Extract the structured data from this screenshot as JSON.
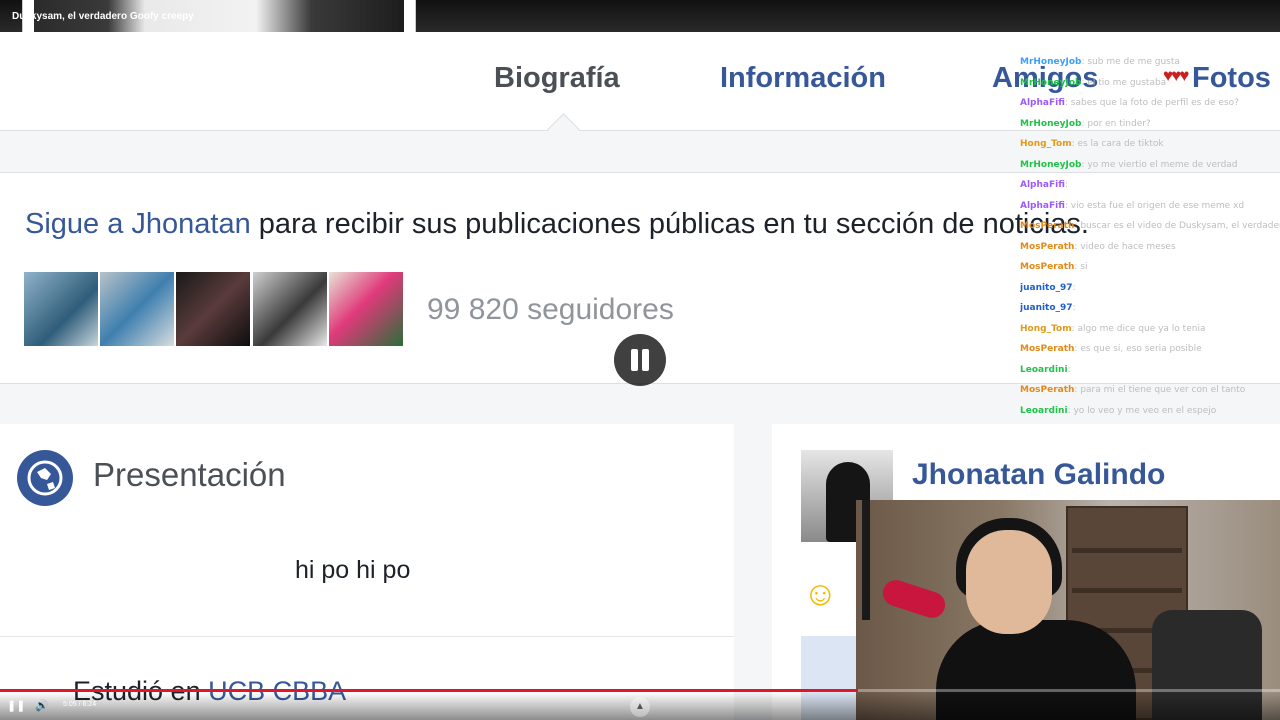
{
  "video": {
    "title": "Duskysam, el verdadero Goofy creepy",
    "time": "5:05 / 6:24",
    "progress": 0.67
  },
  "profile": {
    "tabs": [
      "Biografía",
      "Información",
      "Amigos",
      "Fotos"
    ],
    "follow_link": "Sigue a Jhonatan",
    "follow_rest": " para recibir sus publicaciones públicas en tu sección de noticias.",
    "followers": "99 820 seguidores",
    "intro_title": "Presentación",
    "bio": "hi po hi po",
    "studied_prefix": "Estudió en ",
    "studied_school": "UCB CBBA",
    "side_name": "Jhonatan Galindo"
  },
  "chat": [
    {
      "user": "MrHoneyJob",
      "color": "#3aa0ff",
      "msg": ": sub me de me gusta"
    },
    {
      "user": "MrHoneyJob",
      "color": "#21c24a",
      "msg": ": el tio me gustaba"
    },
    {
      "user": "AlphaFifi",
      "color": "#9b59ff",
      "msg": ": sabes que la foto de perfil es de eso?"
    },
    {
      "user": "MrHoneyJob",
      "color": "#21c24a",
      "msg": ": por en tinder?"
    },
    {
      "user": "Hong_Tom",
      "color": "#e39a1a",
      "msg": ": es la cara de tiktok"
    },
    {
      "user": "MrHoneyJob",
      "color": "#21c24a",
      "msg": ": yo me viertio el meme de verdad"
    },
    {
      "user": "AlphaFifi",
      "color": "#9b59ff",
      "msg": ": "
    },
    {
      "user": "AlphaFifi",
      "color": "#9b59ff",
      "msg": ": vio esta fue el origen de ese meme xd"
    },
    {
      "user": "MosPerath",
      "color": "#e38a1a",
      "msg": ": buscar es el video de Duskysam, el verdadero Goofy creepy, fue el que subio el primero"
    },
    {
      "user": "MosPerath",
      "color": "#e38a1a",
      "msg": ": video de hace meses"
    },
    {
      "user": "MosPerath",
      "color": "#e38a1a",
      "msg": ": si"
    },
    {
      "user": "juanito_97",
      "color": "#1e5fcc",
      "msg": ": "
    },
    {
      "user": "juanito_97",
      "color": "#1e5fcc",
      "msg": ": "
    },
    {
      "user": "Hong_Tom",
      "color": "#e39a1a",
      "msg": ": algo me dice que ya lo tenia"
    },
    {
      "user": "MosPerath",
      "color": "#e38a1a",
      "msg": ": es que si, eso seria posible"
    },
    {
      "user": "Leoardini",
      "color": "#21c24a",
      "msg": ": "
    },
    {
      "user": "MosPerath",
      "color": "#e38a1a",
      "msg": ": para mi el tiene que ver con el tanto"
    },
    {
      "user": "Leoardini",
      "color": "#21c24a",
      "msg": ": yo lo veo y me veo en el espejo"
    }
  ],
  "icons": {
    "pause_overlay": "pause-icon",
    "globe": "globe-icon",
    "emoji": "smiley-icon",
    "hearts": "hearts-icon"
  },
  "colors": {
    "facebook_blue": "#365899",
    "progress_red": "#e0162b"
  }
}
